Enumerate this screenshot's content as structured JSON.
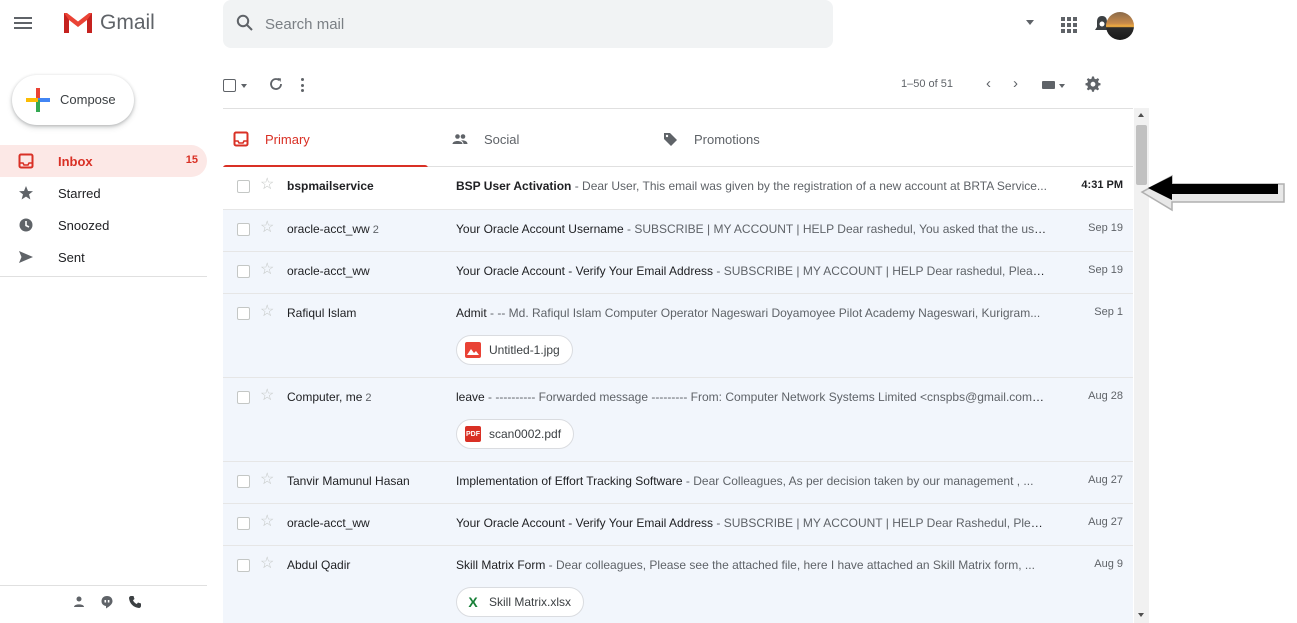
{
  "header": {
    "app_name": "Gmail",
    "search_placeholder": "Search mail"
  },
  "sidebar": {
    "compose_label": "Compose",
    "items": [
      {
        "label": "Inbox",
        "count": "15",
        "icon": "inbox-icon",
        "active": true
      },
      {
        "label": "Starred",
        "count": "",
        "icon": "star-icon",
        "active": false
      },
      {
        "label": "Snoozed",
        "count": "",
        "icon": "clock-icon",
        "active": false
      },
      {
        "label": "Sent",
        "count": "",
        "icon": "send-icon",
        "active": false
      }
    ]
  },
  "toolbar": {
    "range_label": "1–50 of 51",
    "prev": "‹",
    "next": "›"
  },
  "tabs": [
    {
      "label": "Primary",
      "icon": "inbox-icon",
      "active": true
    },
    {
      "label": "Social",
      "icon": "people-icon",
      "active": false
    },
    {
      "label": "Promotions",
      "icon": "tag-icon",
      "active": false
    }
  ],
  "emails": [
    {
      "sender": "bspmailservice",
      "count": "",
      "subject": "BSP User Activation",
      "snippet": " - Dear User, This email was given by the registration of a new account at BRTA Service...",
      "date": "4:31 PM",
      "unread": true
    },
    {
      "sender": "oracle-acct_ww",
      "count": "2",
      "subject": "Your Oracle Account Username",
      "snippet": " - SUBSCRIBE | MY ACCOUNT | HELP Dear rashedul, You asked that the user...",
      "date": "Sep 19",
      "unread": false
    },
    {
      "sender": "oracle-acct_ww",
      "count": "",
      "subject": "Your Oracle Account - Verify Your Email Address",
      "snippet": " - SUBSCRIBE | MY ACCOUNT | HELP Dear rashedul, Please...",
      "date": "Sep 19",
      "unread": false
    },
    {
      "sender": "Rafiqul Islam",
      "count": "",
      "subject": "Admit",
      "snippet": " - -- Md. Rafiqul Islam Computer Operator Nageswari Doyamoyee Pilot Academy Nageswari, Kurigram...",
      "date": "Sep 1",
      "unread": false,
      "attachment": "Untitled-1.jpg"
    },
    {
      "sender": "Computer, me",
      "count": "2",
      "subject": "leave",
      "snippet": " - ---------- Forwarded message --------- From: Computer Network Systems Limited <cnspbs@gmail.com> ...",
      "date": "Aug 28",
      "unread": false,
      "attachment": "scan0002.pdf"
    },
    {
      "sender": "Tanvir Mamunul Hasan",
      "count": "",
      "subject": "Implementation of Effort Tracking Software",
      "snippet": " - Dear Colleagues, As per decision taken by our management , ...",
      "date": "Aug 27",
      "unread": false
    },
    {
      "sender": "oracle-acct_ww",
      "count": "",
      "subject": "Your Oracle Account - Verify Your Email Address",
      "snippet": " - SUBSCRIBE | MY ACCOUNT | HELP Dear Rashedul, Pleas...",
      "date": "Aug 27",
      "unread": false
    },
    {
      "sender": "Abdul Qadir",
      "count": "",
      "subject": "Skill Matrix Form",
      "snippet": " - Dear colleagues, Please see the attached file, here I have attached an Skill Matrix form, ...",
      "date": "Aug 9",
      "unread": false,
      "attachment": "Skill Matrix.xlsx"
    }
  ],
  "colors": {
    "accent": "#d93025",
    "unread_row": "#ffffff",
    "read_row": "#f2f6fc"
  }
}
